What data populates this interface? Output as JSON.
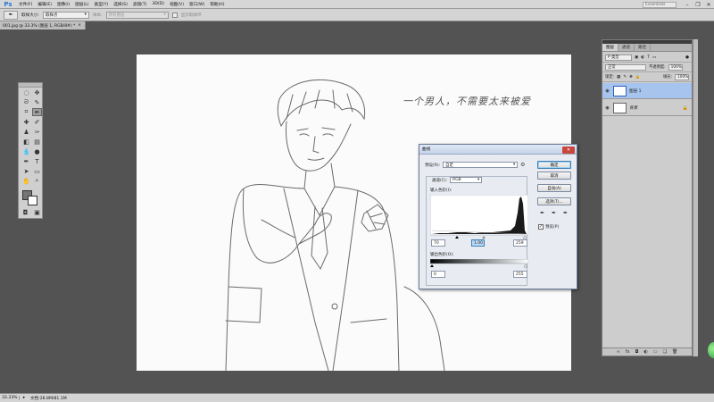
{
  "app": {
    "logo": "Ps"
  },
  "menu": [
    "文件(F)",
    "编辑(E)",
    "图像(I)",
    "图层(L)",
    "类型(Y)",
    "选择(S)",
    "滤镜(T)",
    "3D(D)",
    "视图(V)",
    "窗口(W)",
    "帮助(H)"
  ],
  "workspace": {
    "label": "Essentials"
  },
  "options": {
    "sample_size_label": "取样大小:",
    "sample_size_value": "取样点",
    "sample_label": "样本:",
    "sample_value": "所有图层",
    "show_ring_label": "显示取样环"
  },
  "document": {
    "tab_label": "001.jpg @ 33.3% (图层 1, RGB/8#) *"
  },
  "status": {
    "zoom": "33.33%",
    "doc_info": "文档:28.8M/81.1M"
  },
  "canvas": {
    "handwriting": "一个男人，不需要太来被爱"
  },
  "layers_panel": {
    "tabs": [
      "图层",
      "通道",
      "路径"
    ],
    "filter_kind": "P 类型",
    "blend_mode": "正常",
    "opacity_label": "不透明度:",
    "opacity_value": "100%",
    "lock_label": "锁定:",
    "fill_label": "填充:",
    "fill_value": "100%",
    "layers": [
      {
        "name": "图层 1",
        "selected": true
      },
      {
        "name": "背景",
        "selected": false
      }
    ],
    "footer_icons": [
      "link-icon",
      "fx-icon",
      "mask-icon",
      "adjustment-icon",
      "folder-icon",
      "new-layer-icon",
      "trash-icon"
    ]
  },
  "curves_dialog": {
    "title": "曲线",
    "preset_label": "预设(R):",
    "preset_value": "自定",
    "channel_label": "通道(C):",
    "channel_value": "RGB",
    "input_levels_label": "输入色阶(I):",
    "input_black": "70",
    "input_gray": "1.00",
    "input_white": "259",
    "output_levels_label": "输出色阶(O):",
    "output_black": "0",
    "output_white": "255",
    "buttons": {
      "ok": "确定",
      "cancel": "取消",
      "auto": "自动(A)",
      "options": "选项(T)..."
    },
    "preview_label": "预览(P)",
    "preview_checked": true
  }
}
